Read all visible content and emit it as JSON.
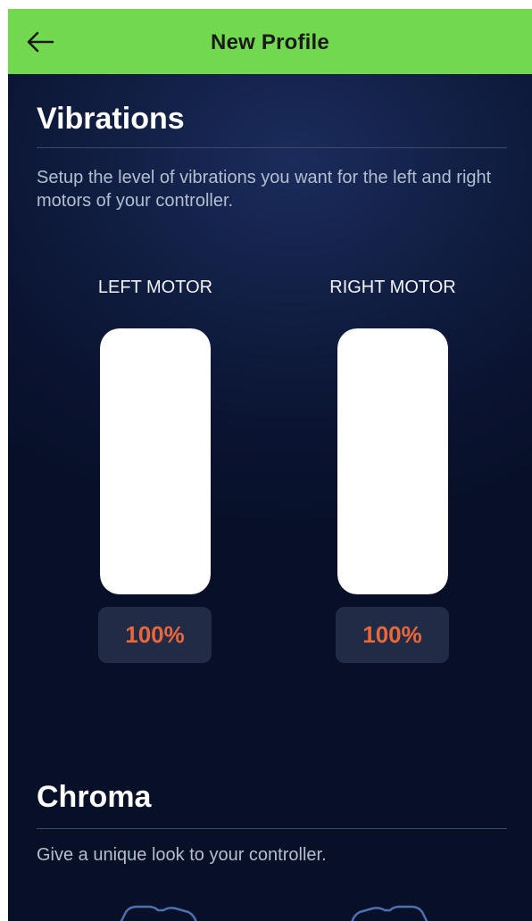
{
  "header": {
    "title": "New Profile",
    "back_icon": "arrow-left-icon",
    "color": "#72d84f"
  },
  "vibrations": {
    "title": "Vibrations",
    "description": "Setup the level of vibrations you want for the left and right motors of your controller.",
    "left_motor": {
      "label": "LEFT MOTOR",
      "percent_text": "100%",
      "level": 1.0
    },
    "right_motor": {
      "label": "RIGHT MOTOR",
      "percent_text": "100%",
      "level": 1.0
    },
    "accent_color": "#e9673b"
  },
  "chroma": {
    "title": "Chroma",
    "description": "Give a unique look to your controller.",
    "icons": [
      "controller-left-icon",
      "controller-right-icon"
    ]
  }
}
